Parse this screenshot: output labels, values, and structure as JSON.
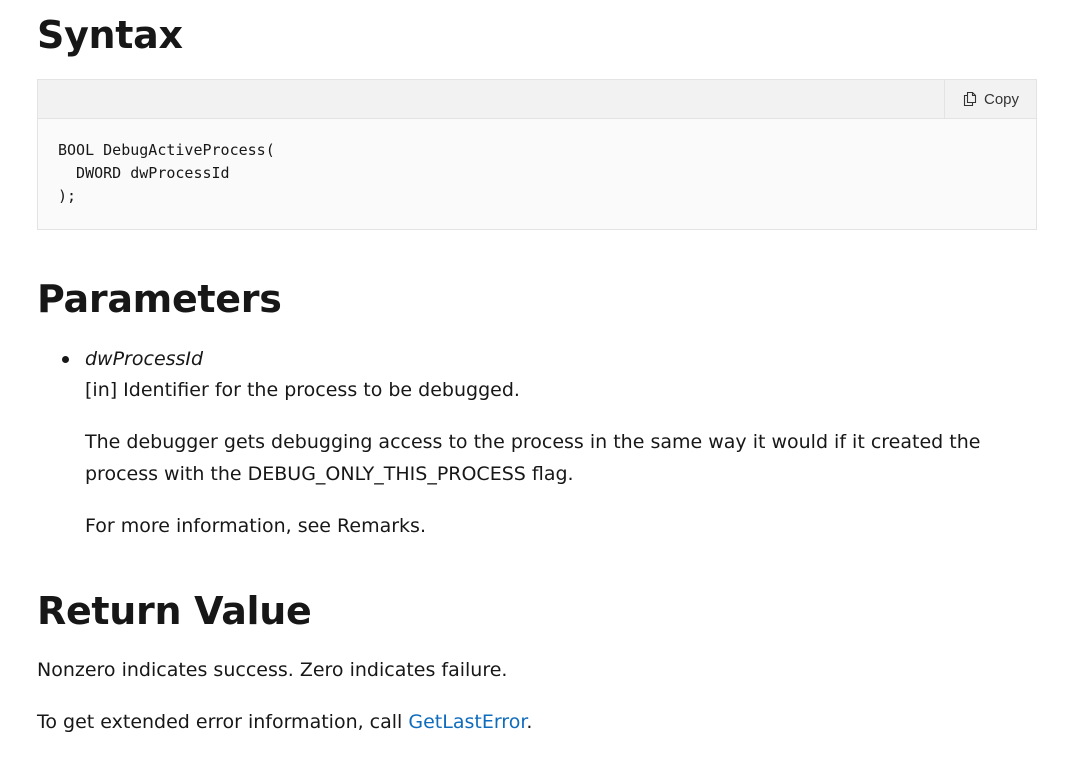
{
  "syntax": {
    "heading": "Syntax",
    "copy_label": "Copy",
    "code": "BOOL DebugActiveProcess(\n  DWORD dwProcessId\n);"
  },
  "parameters": {
    "heading": "Parameters",
    "items": [
      {
        "name": "dwProcessId",
        "description": "[in] Identifier for the process to be debugged.",
        "detail": "The debugger gets debugging access to the process in the same way it would if it created the process with the DEBUG_ONLY_THIS_PROCESS flag.",
        "more_info": "For more information, see Remarks."
      }
    ]
  },
  "return_value": {
    "heading": "Return Value",
    "line1": "Nonzero indicates success. Zero indicates failure.",
    "line2_prefix": "To get extended error information, call ",
    "line2_link": "GetLastError",
    "line2_suffix": "."
  },
  "colors": {
    "link": "#0f6cbd",
    "text": "#171717",
    "code_header_bg": "#f2f2f2",
    "code_bg": "#fafafa"
  }
}
